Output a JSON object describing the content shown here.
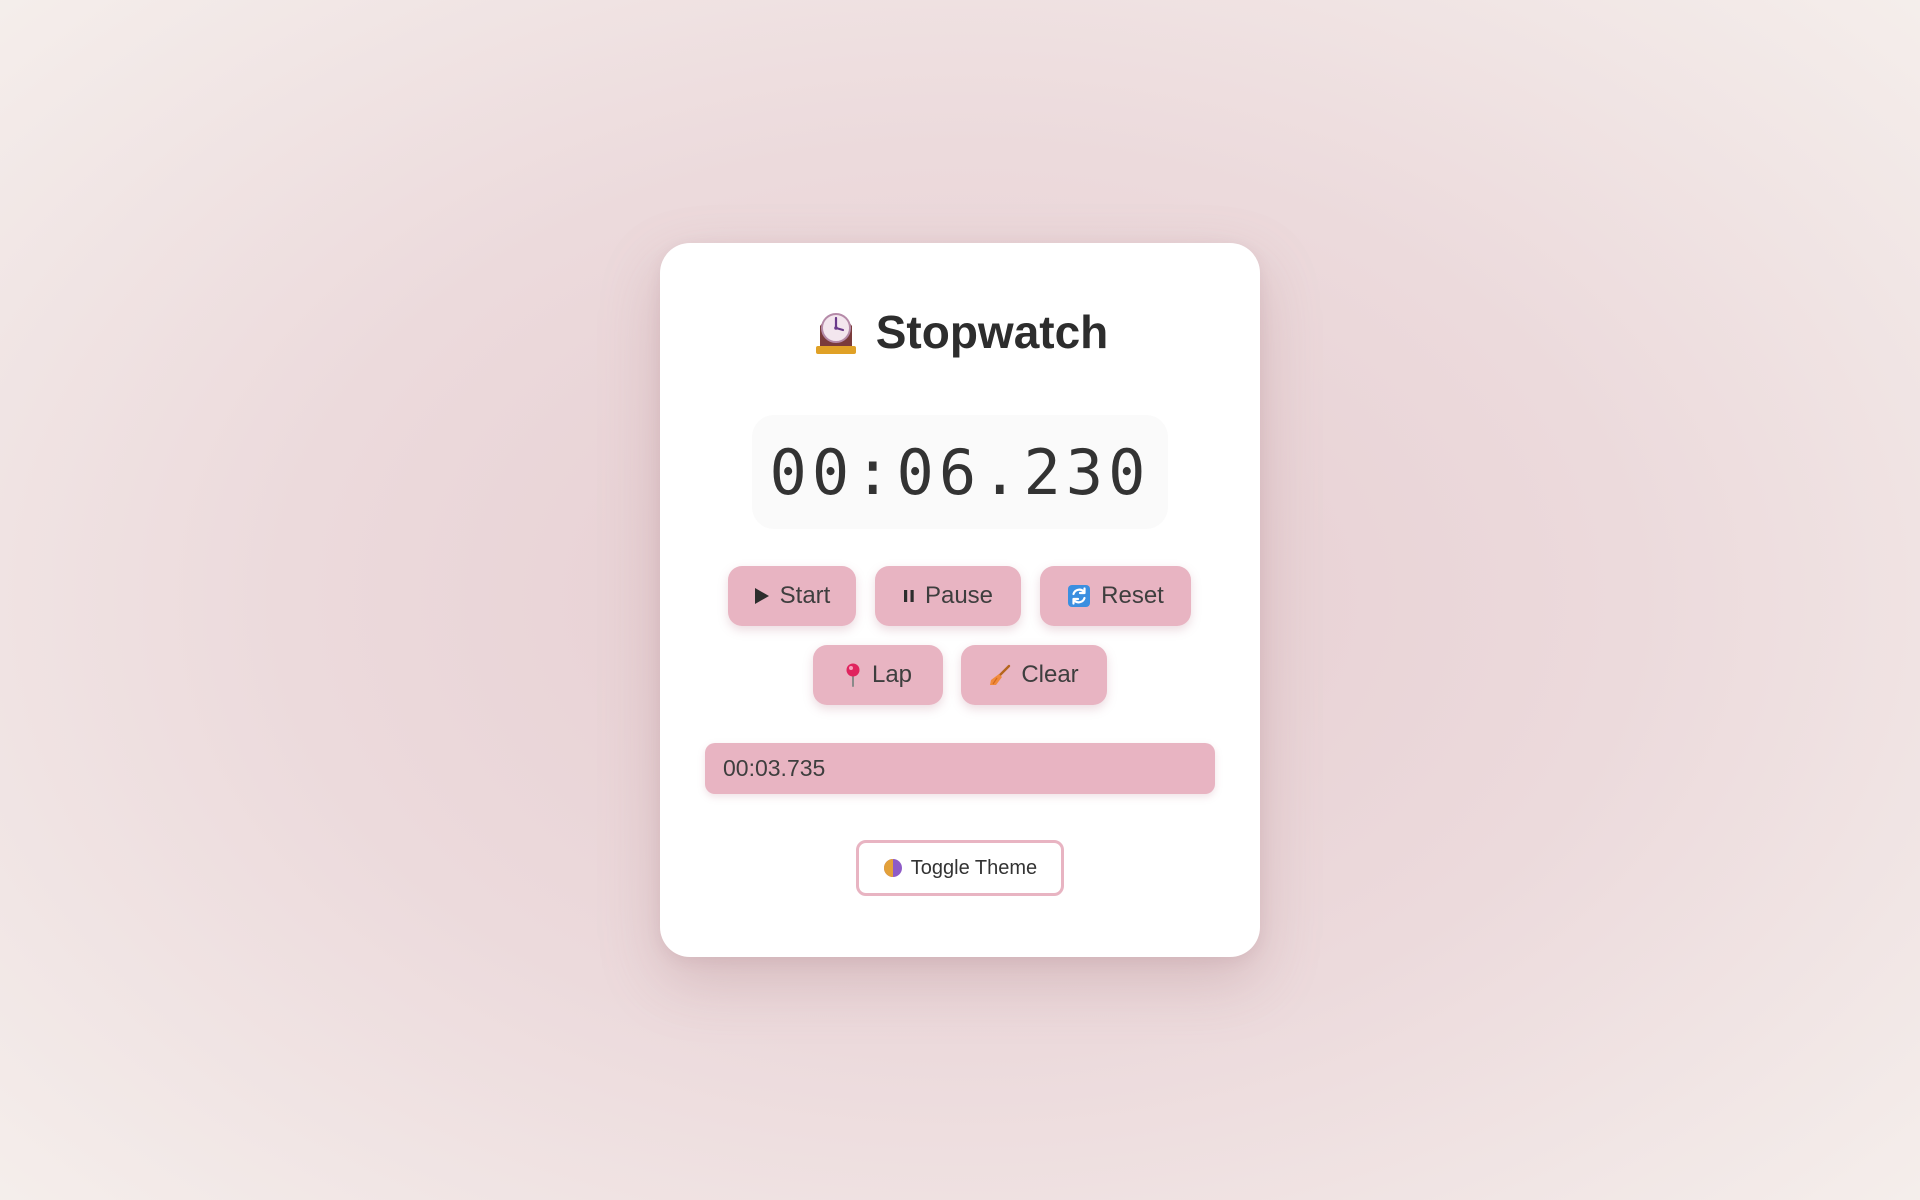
{
  "app": {
    "title": "Stopwatch",
    "title_icon": "mantelpiece-clock-icon"
  },
  "display": {
    "time": "00:06.230"
  },
  "controls": {
    "start_label": "Start",
    "start_icon": "play-icon",
    "pause_label": "Pause",
    "pause_icon": "pause-icon",
    "reset_label": "Reset",
    "reset_icon": "refresh-arrows-icon",
    "lap_label": "Lap",
    "lap_icon": "pushpin-icon",
    "clear_label": "Clear",
    "clear_icon": "broom-icon"
  },
  "laps": [
    {
      "time": "00:03.735"
    }
  ],
  "theme": {
    "toggle_label": "Toggle Theme",
    "toggle_icon": "half-moon-circle-icon"
  },
  "colors": {
    "button_bg": "#e8b4c2",
    "card_bg": "#ffffff",
    "text": "#2d2d2d"
  }
}
